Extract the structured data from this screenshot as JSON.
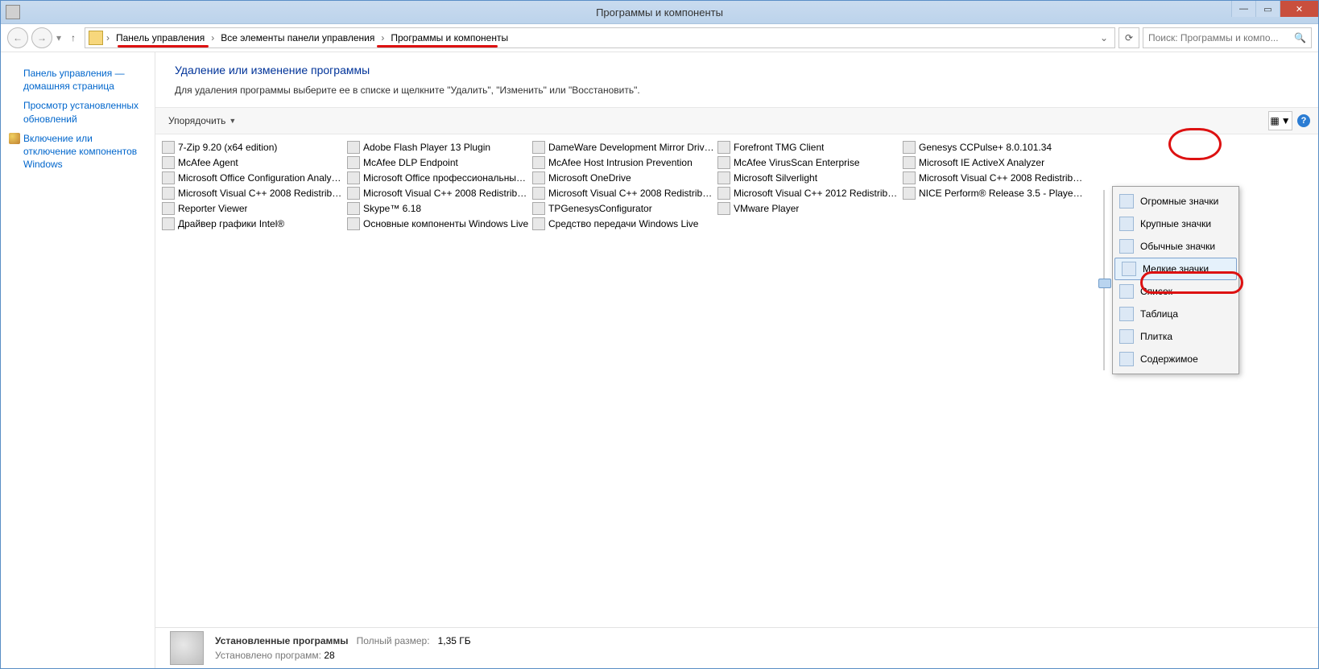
{
  "window": {
    "title": "Программы и компоненты"
  },
  "breadcrumb": {
    "root_sep": "›",
    "item0": "Панель управления",
    "item1": "Все элементы панели управления",
    "item2": "Программы и компоненты"
  },
  "search": {
    "placeholder": "Поиск: Программы и компо..."
  },
  "sidebar": {
    "home": "Панель управления — домашняя страница",
    "updates": "Просмотр установленных обновлений",
    "features": "Включение или отключение компонентов Windows"
  },
  "main": {
    "heading": "Удаление или изменение программы",
    "desc": "Для удаления программы выберите ее в списке и щелкните \"Удалить\", \"Изменить\" или \"Восстановить\"."
  },
  "toolbar": {
    "organize": "Упорядочить"
  },
  "programs": {
    "col0": [
      "7-Zip 9.20 (x64 edition)",
      "McAfee Agent",
      "Microsoft Office Configuration Analyzer...",
      "Microsoft Visual C++ 2008 Redistributa...",
      "Reporter Viewer",
      "Драйвер графики Intel®"
    ],
    "col1": [
      "Adobe Flash Player 13 Plugin",
      "McAfee DLP Endpoint",
      "Microsoft Office профессиональный п...",
      "Microsoft Visual C++ 2008 Redistributa...",
      "Skype™ 6.18",
      "Основные компоненты Windows Live"
    ],
    "col2": [
      "DameWare Development Mirror Driver ...",
      "McAfee Host Intrusion Prevention",
      "Microsoft OneDrive",
      "Microsoft Visual C++ 2008 Redistributa...",
      "TPGenesysConfigurator",
      "Средство передачи Windows Live"
    ],
    "col3": [
      "Forefront TMG Client",
      "McAfee VirusScan Enterprise",
      "Microsoft Silverlight",
      "Microsoft Visual C++ 2012 Redistributa...",
      "VMware Player"
    ],
    "col4": [
      "Genesys CCPulse+ 8.0.101.34",
      "Microsoft IE ActiveX Analyzer",
      "Microsoft Visual C++ 2008 Redistributa...",
      "NICE Perform® Release 3.5 - Player Co..."
    ]
  },
  "viewmenu": {
    "items": [
      "Огромные значки",
      "Крупные значки",
      "Обычные значки",
      "Мелкие значки",
      "Список",
      "Таблица",
      "Плитка",
      "Содержимое"
    ],
    "selected_index": 3
  },
  "status": {
    "title": "Установленные программы",
    "size_label": "Полный размер:",
    "size_value": "1,35 ГБ",
    "count_label": "Установлено программ:",
    "count_value": "28"
  }
}
